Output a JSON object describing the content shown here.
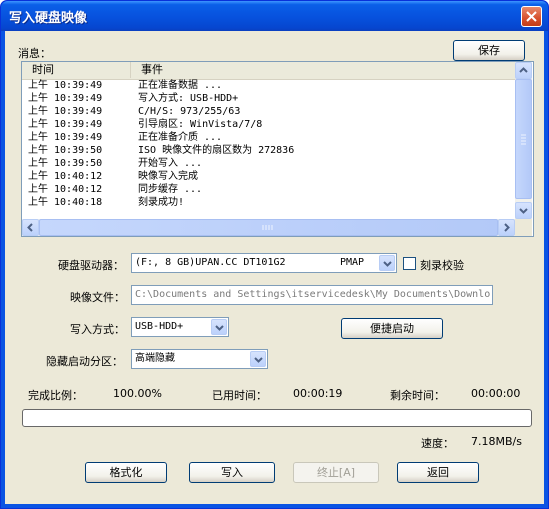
{
  "window": {
    "title": "写入硬盘映像"
  },
  "messages_label": "消息：",
  "save_button": "保存",
  "log": {
    "columns": [
      "时间",
      "事件"
    ],
    "rows": [
      {
        "time": "上午 10:39:49",
        "event": "正在准备数据 ..."
      },
      {
        "time": "上午 10:39:49",
        "event": "写入方式: USB-HDD+"
      },
      {
        "time": "上午 10:39:49",
        "event": "C/H/S: 973/255/63"
      },
      {
        "time": "上午 10:39:49",
        "event": "引导扇区: WinVista/7/8"
      },
      {
        "time": "上午 10:39:49",
        "event": "正在准备介质 ..."
      },
      {
        "time": "上午 10:39:50",
        "event": "ISO 映像文件的扇区数为 272836"
      },
      {
        "time": "上午 10:39:50",
        "event": "开始写入 ..."
      },
      {
        "time": "上午 10:40:12",
        "event": "映像写入完成"
      },
      {
        "time": "上午 10:40:12",
        "event": "同步缓存 ..."
      },
      {
        "time": "上午 10:40:18",
        "event": "刻录成功!"
      }
    ]
  },
  "drive": {
    "label": "硬盘驱动器：",
    "value": "(F:, 8 GB)UPAN.CC DT101G2",
    "mode": "PMAP"
  },
  "verify_checkbox": {
    "label": "刻录校验",
    "checked": false
  },
  "image_file": {
    "label": "映像文件：",
    "value": "C:\\Documents and Settings\\itservicedesk\\My Documents\\Downlo"
  },
  "write_mode": {
    "label": "写入方式：",
    "value": "USB-HDD+"
  },
  "quick_boot_button": "便捷启动",
  "hidden_partition": {
    "label": "隐藏启动分区：",
    "value": "高端隐藏"
  },
  "stats": {
    "complete_label": "完成比例：",
    "complete_value": "100.00%",
    "elapsed_label": "已用时间：",
    "elapsed_value": "00:00:19",
    "remaining_label": "剩余时间：",
    "remaining_value": "00:00:00",
    "speed_label": "速度：",
    "speed_value": "7.18MB/s"
  },
  "progress_fraction": 0,
  "buttons": {
    "format": "格式化",
    "write": "写入",
    "abort": "终止[A]",
    "back": "返回"
  },
  "colors": {
    "title_bar": "#0a54e3",
    "dialog_bg": "#ece9d8",
    "close_button": "#d7502c"
  }
}
